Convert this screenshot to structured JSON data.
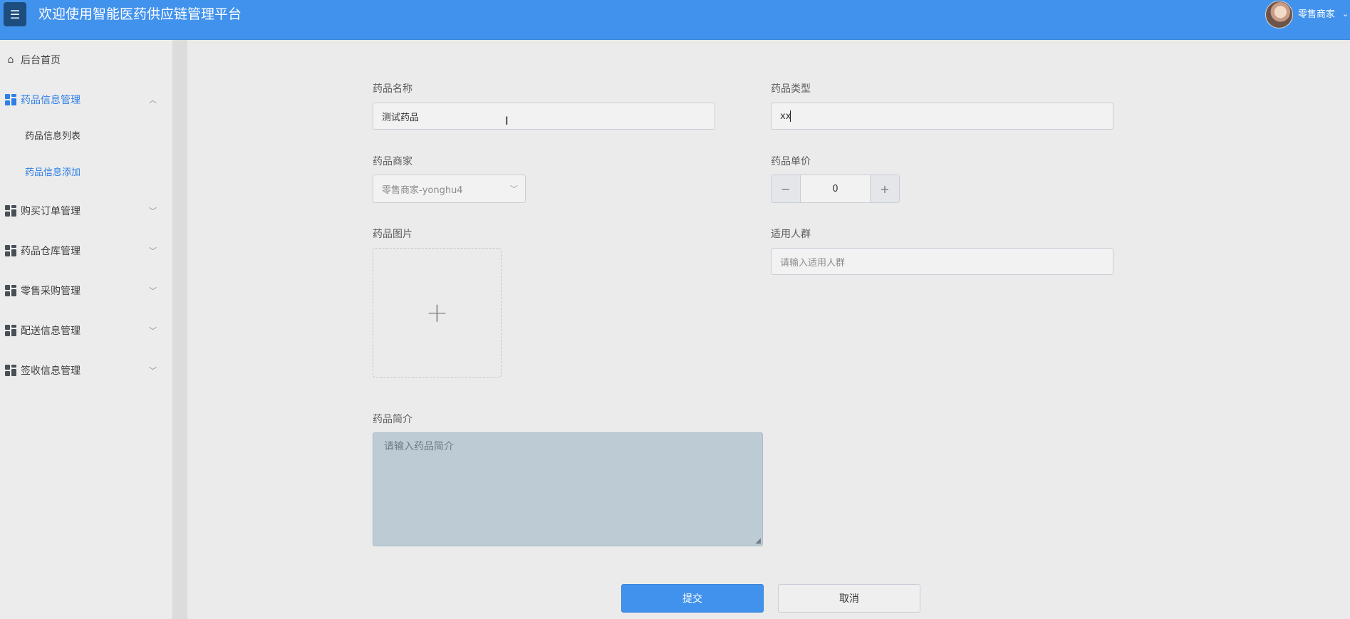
{
  "header": {
    "menu_icon": "menu-icon",
    "title": "欢迎使用智能医药供应链管理平台",
    "user_name": "零售商家",
    "user_caret": "⌄"
  },
  "sidebar": {
    "home": {
      "label": "后台首页",
      "icon": "home-icon"
    },
    "groups": [
      {
        "label": "药品信息管理",
        "expanded": true,
        "active": true
      },
      {
        "label": "购买订单管理"
      },
      {
        "label": "药品仓库管理"
      },
      {
        "label": "零售采购管理"
      },
      {
        "label": "配送信息管理"
      },
      {
        "label": "签收信息管理"
      }
    ],
    "sub_items": [
      {
        "label": "药品信息列表"
      },
      {
        "label": "药品信息添加",
        "active": true
      }
    ]
  },
  "form": {
    "name": {
      "label": "药品名称",
      "value": "测试药品"
    },
    "type": {
      "label": "药品类型",
      "value": "xx"
    },
    "merchant": {
      "label": "药品商家",
      "value": "零售商家-yonghu4"
    },
    "price": {
      "label": "药品单价",
      "value": "0",
      "minus": "−",
      "plus": "+"
    },
    "image": {
      "label": "药品图片",
      "plus": "+"
    },
    "audience": {
      "label": "适用人群",
      "placeholder": "请输入适用人群"
    },
    "intro": {
      "label": "药品简介",
      "placeholder": "请输入药品简介"
    },
    "submit_label": "提交",
    "cancel_label": "取消"
  },
  "colors": {
    "header": "#4192ec",
    "accent": "#2e7fe6",
    "textarea_bg": "#bccbd4"
  }
}
